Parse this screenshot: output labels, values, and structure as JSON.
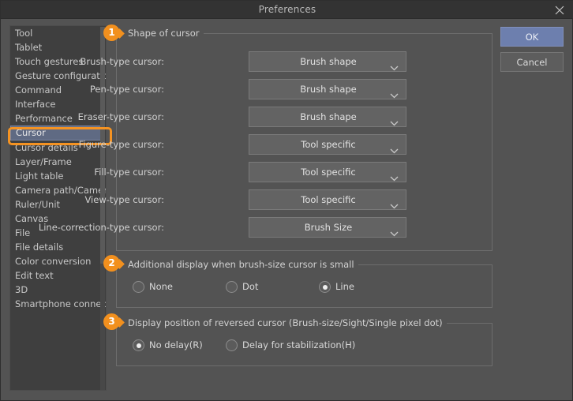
{
  "window": {
    "title": "Preferences",
    "close_icon": "close-icon"
  },
  "sidebar": {
    "items": [
      {
        "label": "Tool",
        "selected": false
      },
      {
        "label": "Tablet",
        "selected": false
      },
      {
        "label": "Touch gestures",
        "selected": false
      },
      {
        "label": "Gesture configuration",
        "selected": false
      },
      {
        "label": "Command",
        "selected": false
      },
      {
        "label": "Interface",
        "selected": false
      },
      {
        "label": "Performance",
        "selected": false
      },
      {
        "label": "Cursor",
        "selected": true
      },
      {
        "label": "Cursor details",
        "selected": false
      },
      {
        "label": "Layer/Frame",
        "selected": false
      },
      {
        "label": "Light table",
        "selected": false
      },
      {
        "label": "Camera path/Camera",
        "selected": false
      },
      {
        "label": "Ruler/Unit",
        "selected": false
      },
      {
        "label": "Canvas",
        "selected": false
      },
      {
        "label": "File",
        "selected": false
      },
      {
        "label": "File details",
        "selected": false
      },
      {
        "label": "Color conversion",
        "selected": false
      },
      {
        "label": "Edit text",
        "selected": false
      },
      {
        "label": "3D",
        "selected": false
      },
      {
        "label": "Smartphone connection",
        "selected": false
      }
    ]
  },
  "badges": {
    "one": "1",
    "two": "2",
    "three": "3"
  },
  "groups": {
    "shape_of_cursor": {
      "title": "Shape of cursor",
      "rows": [
        {
          "label": "Brush-type cursor:",
          "value": "Brush shape"
        },
        {
          "label": "Pen-type cursor:",
          "value": "Brush shape"
        },
        {
          "label": "Eraser-type cursor:",
          "value": "Brush shape"
        },
        {
          "label": "Figure-type cursor:",
          "value": "Tool specific"
        },
        {
          "label": "Fill-type cursor:",
          "value": "Tool specific"
        },
        {
          "label": "View-type cursor:",
          "value": "Tool specific"
        },
        {
          "label": "Line-correction-type cursor:",
          "value": "Brush Size"
        }
      ]
    },
    "additional_display": {
      "title": "Additional display when brush-size cursor is small",
      "options": [
        {
          "label": "None",
          "checked": false
        },
        {
          "label": "Dot",
          "checked": false
        },
        {
          "label": "Line",
          "checked": true
        }
      ]
    },
    "reversed_cursor": {
      "title": "Display position of reversed cursor (Brush-size/Sight/Single pixel dot)",
      "options": [
        {
          "label": "No delay(R)",
          "checked": true
        },
        {
          "label": "Delay for stabilization(H)",
          "checked": false
        }
      ]
    }
  },
  "buttons": {
    "ok": "OK",
    "cancel": "Cancel"
  },
  "colors": {
    "accent_orange": "#f2901e",
    "selection_blue": "#5f6a83",
    "ok_button_blue": "#6d7fae",
    "dialog_bg": "#535353",
    "sidebar_bg": "#3f3f3f"
  }
}
